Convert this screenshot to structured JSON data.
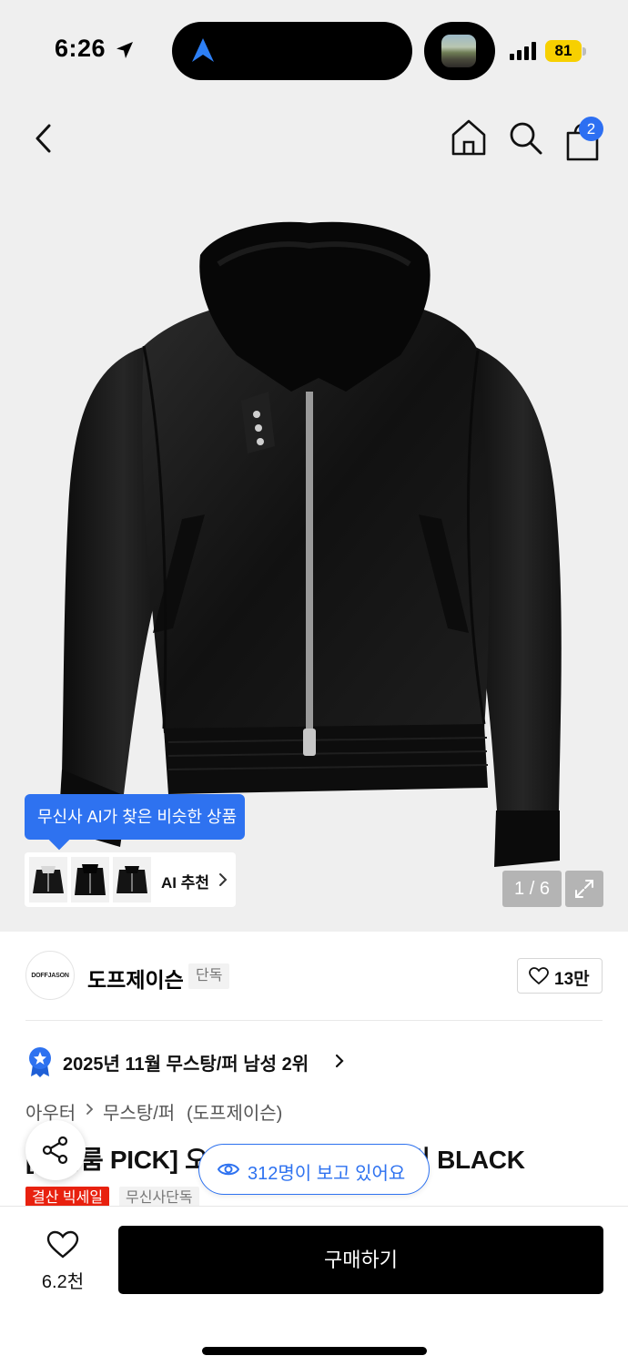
{
  "status_bar": {
    "time": "6:26",
    "battery": "81",
    "icons": [
      "location-arrow-icon",
      "maps-nav-icon",
      "signal-icon",
      "battery-icon"
    ]
  },
  "header": {
    "icons": [
      "back-chevron-icon",
      "home-icon",
      "search-icon",
      "shopping-bag-icon"
    ],
    "cart_badge": "2"
  },
  "gallery": {
    "ai_tooltip": "무신사 AI가 찾은 비슷한 상품",
    "ai_recommend_label": "AI 추천",
    "page_counter": "1 / 6"
  },
  "brand": {
    "logo_text": "DOFFJASON",
    "name": "도프제이슨",
    "exclusive_tag": "단독",
    "like_count": "13만"
  },
  "ranking": {
    "text": "2025년 11월 무스탕/퍼 남성 2위"
  },
  "breadcrumb": {
    "level1": "아우터",
    "level2": "무스탕/퍼",
    "brand": "(도프제이슨)"
  },
  "product": {
    "title": "[쇼리룸 PICK] 오버사이즈 무스탕 봄버 BLACK",
    "viewers": "312명이 보고 있어요",
    "tags": [
      "결산 빅세일",
      "무신사단독"
    ]
  },
  "bottom_bar": {
    "wish_count": "6.2천",
    "buy_label": "구매하기"
  },
  "colors": {
    "accent_blue": "#2e72f0",
    "sale_red": "#e8210f",
    "battery_yellow": "#f7d000"
  }
}
